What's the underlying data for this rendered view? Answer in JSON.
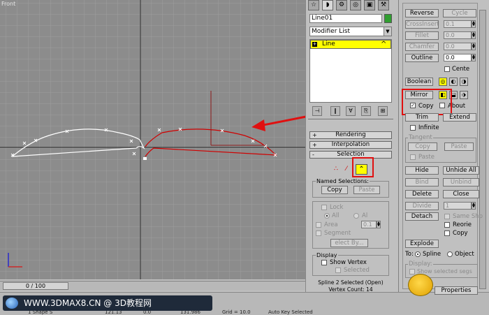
{
  "viewport": {
    "label": "Front"
  },
  "timeslider": {
    "value": "0 / 100"
  },
  "watermark": {
    "text": "WWW.3DMAX8.CN @ 3D教程网"
  },
  "statusbar": {
    "selection": "1 Shape S",
    "x_value": "121.13",
    "y_value": "0.0",
    "z_value": "131.986",
    "grid": "Grid = 10.0",
    "autokey": "Auto Key  Selected"
  },
  "command_panel": {
    "tab_icons": [
      "create-icon",
      "modify-icon",
      "hierarchy-icon",
      "motion-icon",
      "display-icon",
      "utilities-icon"
    ],
    "tab_glyphs": [
      "☆",
      "◗",
      "⚙",
      "◎",
      "▣",
      "⚒"
    ],
    "object_name": "Line01",
    "object_color": "#2f9e2f",
    "modifier_list": "Modifier List",
    "stack_item": "Line",
    "stack_tool_glyphs": [
      "⊣",
      "‖",
      "∀",
      "⎘",
      "⊞"
    ],
    "rollouts": {
      "rendering": {
        "sign": "+",
        "label": "Rendering"
      },
      "interpolation": {
        "sign": "+",
        "label": "Interpolation"
      },
      "selection": {
        "sign": "-",
        "label": "Selection"
      }
    },
    "selection": {
      "named_selections": "Named Selections:",
      "copy": "Copy",
      "paste": "Paste",
      "lock": "Lock",
      "all": "All",
      "al": "Al",
      "area": "Area",
      "area_value": "0.1",
      "segment": "Segment",
      "select_by": "elect By...",
      "display": "Display",
      "show_vertex": "Show Vertex",
      "selected": "Selected",
      "info_line1": "Spline 2 Selected (Open)",
      "info_line2": "Vertex Count: 14"
    }
  },
  "geometry_panel": {
    "reverse": "Reverse",
    "cycle": "Cycle",
    "crossinsert": "CrossInsert",
    "crossinsert_value": "0.1",
    "fillet": "Fillet",
    "fillet_value": "0.0",
    "chamfer": "Chamfer",
    "chamfer_value": "0.0",
    "outline": "Outline",
    "outline_value": "0.0",
    "center": "Cente",
    "boolean": "Boolean",
    "mirror": "Mirror",
    "copy": "Copy",
    "about": "About",
    "trim": "Trim",
    "extend": "Extend",
    "infinite": "Infinite",
    "tangent": "Tangent",
    "tan_copy": "Copy",
    "tan_paste": "Paste",
    "paste_chk": "Paste",
    "hide": "Hide",
    "unhide_all": "Unhide All",
    "bind": "Bind",
    "unbind": "Unbind",
    "delete": "Delete",
    "close": "Close",
    "divide": "Divide",
    "divide_value": "1",
    "detach": "Detach",
    "same_shp": "Same Shp",
    "reorient": "Reorie",
    "copy2": "Copy",
    "explode": "Explode",
    "to": "To:",
    "spline": "Spline",
    "object": "Object",
    "display": "Display:",
    "show_selected_seg": "Show selected segs",
    "properties": "Properties"
  }
}
